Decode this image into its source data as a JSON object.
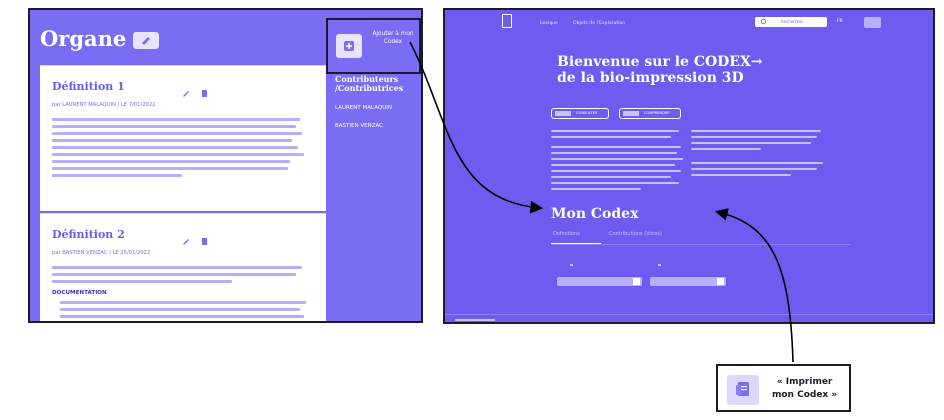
{
  "left_panel": {
    "title": "Organe",
    "definitions": [
      {
        "title": "Définition 1",
        "meta": "par LAURENT MALAQUIN | LE 7/01/2022"
      },
      {
        "title": "Définition 2",
        "meta": "par BASTIEN VENZAC | LE 25/01/2022",
        "doc_label": "DOCUMENTATION"
      }
    ],
    "contributors_heading": "Contributeurs /Contributrices",
    "contributors": [
      "LAURENT MALAQUIN",
      "BASTIEN VENZAC"
    ],
    "add_codex_label": "Ajouter à mon Codex"
  },
  "right_panel": {
    "nav": [
      "Lexique",
      "Objets de l'Exploration"
    ],
    "search_placeholder": "Rechercher",
    "language": "FR",
    "hero_title_line1": "Bienvenue sur le CODEX→",
    "hero_title_line2": "de la bio-impression 3D",
    "buttons": [
      "CONSULTER",
      "COMPRENDRE"
    ],
    "section_title": "Mon Codex",
    "tabs": [
      "Définitions",
      "Contributions (Votes)"
    ]
  },
  "callout": {
    "print_label_line1": "« Imprimer",
    "print_label_line2": "mon Codex »"
  },
  "colors": {
    "primary": "#7a6cf3",
    "dark_border": "#1e1a2e",
    "light": "#e8e4fe"
  },
  "icons": [
    "edit-icon",
    "trash-icon",
    "add-icon",
    "print-icon",
    "logo-icon",
    "search-icon"
  ]
}
